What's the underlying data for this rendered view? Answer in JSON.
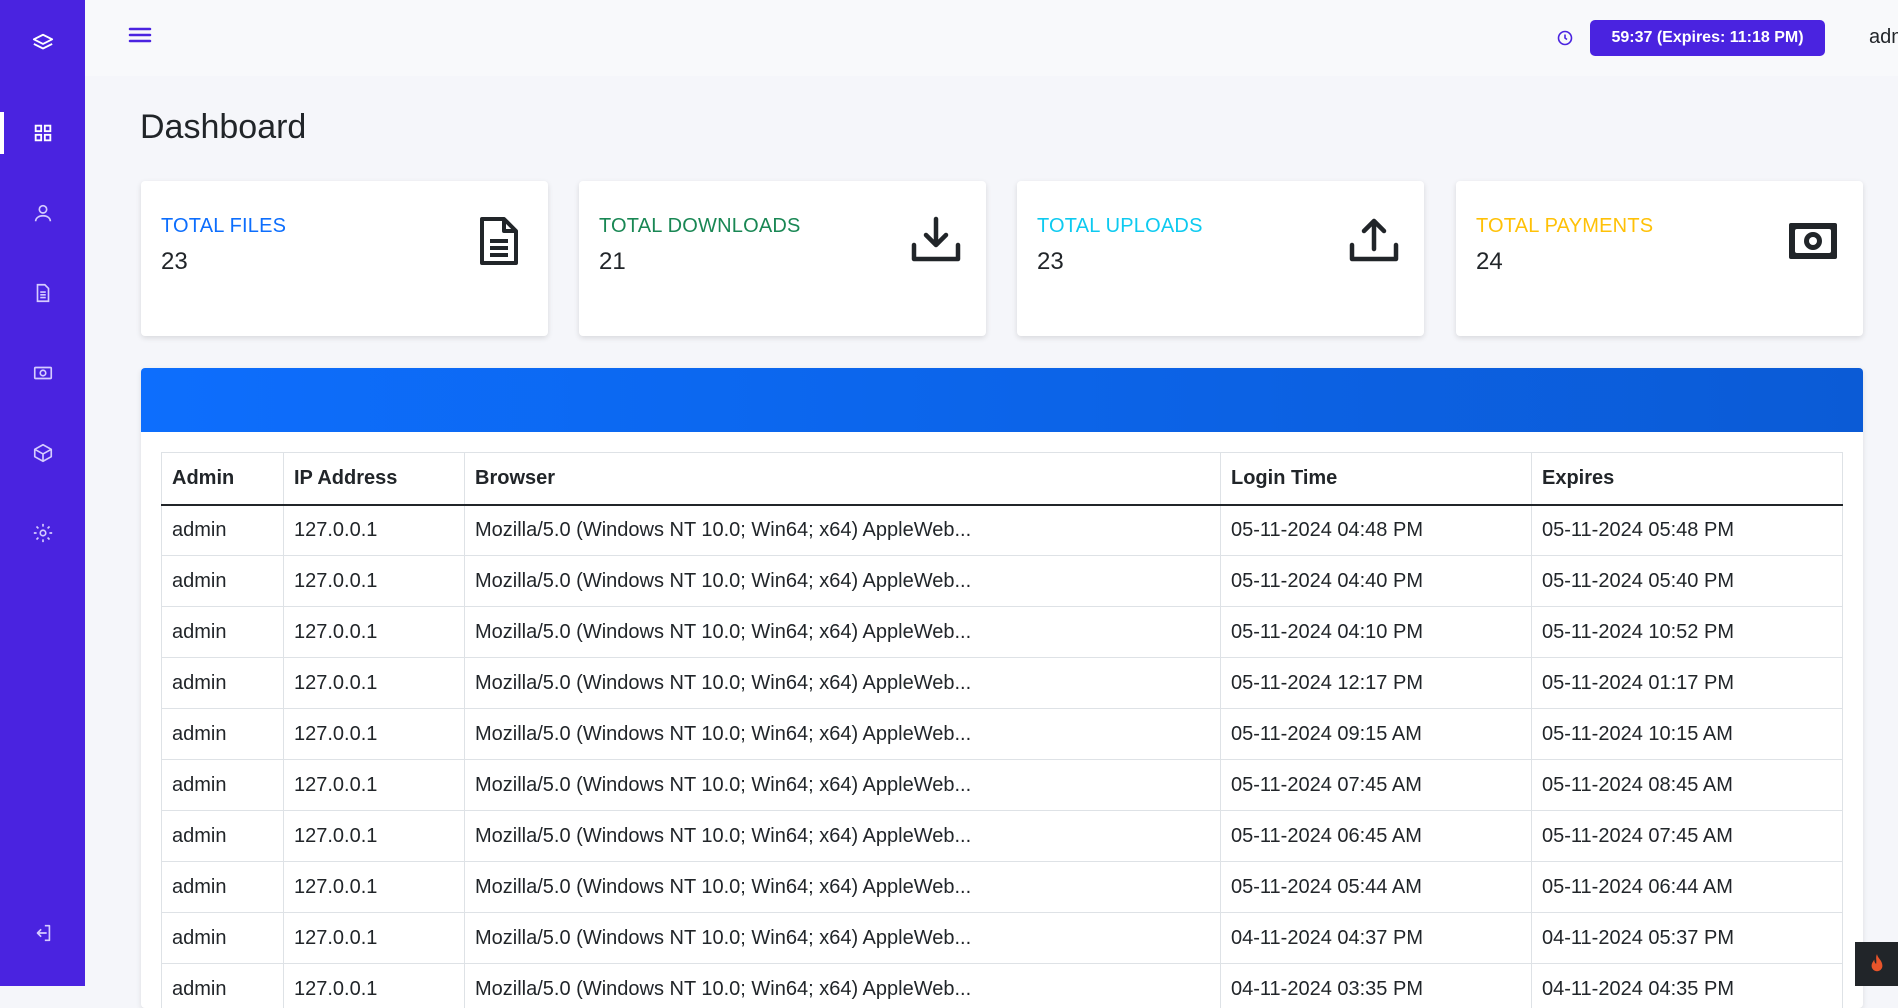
{
  "header": {
    "session_timer": "59:37 (Expires: 11:18 PM)",
    "username": "admin"
  },
  "page": {
    "title": "Dashboard"
  },
  "sidebar": {
    "items": [
      {
        "icon": "layers-icon"
      },
      {
        "icon": "grid-icon",
        "active": true
      },
      {
        "icon": "user-icon"
      },
      {
        "icon": "document-icon"
      },
      {
        "icon": "money-icon"
      },
      {
        "icon": "package-icon"
      },
      {
        "icon": "gear-icon"
      },
      {
        "icon": "logout-icon"
      }
    ]
  },
  "stats": [
    {
      "label": "TOTAL FILES",
      "value": "23",
      "color": "#0d6efd",
      "icon": "file-icon"
    },
    {
      "label": "TOTAL DOWNLOADS",
      "value": "21",
      "color": "#198754",
      "icon": "download-icon"
    },
    {
      "label": "TOTAL UPLOADS",
      "value": "23",
      "color": "#0dcaf0",
      "icon": "upload-icon"
    },
    {
      "label": "TOTAL PAYMENTS",
      "value": "24",
      "color": "#ffc107",
      "icon": "money-icon"
    }
  ],
  "table": {
    "columns": [
      "Admin",
      "IP Address",
      "Browser",
      "Login Time",
      "Expires"
    ],
    "rows": [
      [
        "admin",
        "127.0.0.1",
        "Mozilla/5.0 (Windows NT 10.0; Win64; x64) AppleWeb...",
        "05-11-2024 04:48 PM",
        "05-11-2024 05:48 PM"
      ],
      [
        "admin",
        "127.0.0.1",
        "Mozilla/5.0 (Windows NT 10.0; Win64; x64) AppleWeb...",
        "05-11-2024 04:40 PM",
        "05-11-2024 05:40 PM"
      ],
      [
        "admin",
        "127.0.0.1",
        "Mozilla/5.0 (Windows NT 10.0; Win64; x64) AppleWeb...",
        "05-11-2024 04:10 PM",
        "05-11-2024 10:52 PM"
      ],
      [
        "admin",
        "127.0.0.1",
        "Mozilla/5.0 (Windows NT 10.0; Win64; x64) AppleWeb...",
        "05-11-2024 12:17 PM",
        "05-11-2024 01:17 PM"
      ],
      [
        "admin",
        "127.0.0.1",
        "Mozilla/5.0 (Windows NT 10.0; Win64; x64) AppleWeb...",
        "05-11-2024 09:15 AM",
        "05-11-2024 10:15 AM"
      ],
      [
        "admin",
        "127.0.0.1",
        "Mozilla/5.0 (Windows NT 10.0; Win64; x64) AppleWeb...",
        "05-11-2024 07:45 AM",
        "05-11-2024 08:45 AM"
      ],
      [
        "admin",
        "127.0.0.1",
        "Mozilla/5.0 (Windows NT 10.0; Win64; x64) AppleWeb...",
        "05-11-2024 06:45 AM",
        "05-11-2024 07:45 AM"
      ],
      [
        "admin",
        "127.0.0.1",
        "Mozilla/5.0 (Windows NT 10.0; Win64; x64) AppleWeb...",
        "05-11-2024 05:44 AM",
        "05-11-2024 06:44 AM"
      ],
      [
        "admin",
        "127.0.0.1",
        "Mozilla/5.0 (Windows NT 10.0; Win64; x64) AppleWeb...",
        "04-11-2024 04:37 PM",
        "04-11-2024 05:37 PM"
      ],
      [
        "admin",
        "127.0.0.1",
        "Mozilla/5.0 (Windows NT 10.0; Win64; x64) AppleWeb...",
        "04-11-2024 03:35 PM",
        "04-11-2024 04:35 PM"
      ]
    ]
  },
  "colors": {
    "sidebar": "#4a23e0",
    "accent_blue": "#0d6efd"
  }
}
